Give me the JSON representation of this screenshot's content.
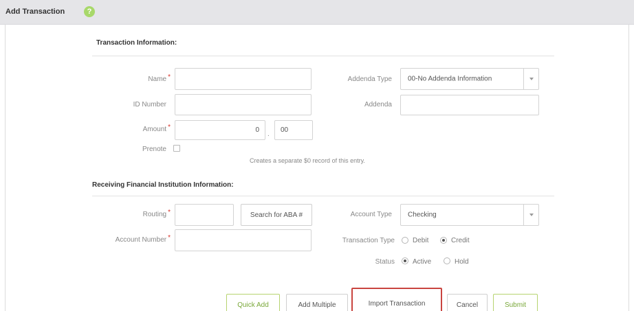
{
  "header": {
    "title": "Add Transaction",
    "help_symbol": "?"
  },
  "transaction_info": {
    "title": "Transaction Information:",
    "name_label": "Name",
    "id_label": "ID Number",
    "amount_label": "Amount",
    "amount_whole": "0",
    "amount_cents": "00",
    "amount_separator": ".",
    "prenote_label": "Prenote",
    "prenote_hint": "Creates a separate $0 record of this entry.",
    "addenda_type_label": "Addenda Type",
    "addenda_type_value": "00-No Addenda Information",
    "addenda_label": "Addenda",
    "required_mark": "*"
  },
  "rfi_info": {
    "title": "Receiving Financial Institution Information:",
    "routing_label": "Routing",
    "search_aba_label": "Search for ABA #",
    "account_number_label": "Account Number",
    "account_type_label": "Account Type",
    "account_type_value": "Checking",
    "transaction_type_label": "Transaction Type",
    "debit_label": "Debit",
    "credit_label": "Credit",
    "status_label": "Status",
    "active_label": "Active",
    "hold_label": "Hold"
  },
  "buttons": {
    "quick_add": "Quick Add",
    "add_multiple": "Add Multiple",
    "import_transaction": "Import Transaction",
    "cancel": "Cancel",
    "submit": "Submit"
  },
  "colors": {
    "accent_green": "#7aa83a",
    "required_red": "#d9342b",
    "highlight_red": "#c9443f"
  }
}
